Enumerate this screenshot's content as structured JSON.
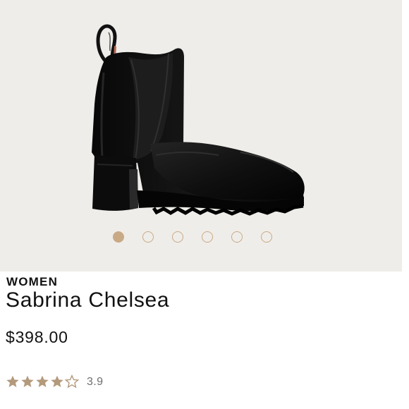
{
  "product": {
    "category": "WOMEN",
    "name": "Sabrina Chelsea",
    "price": "$398.00",
    "image_icon": "black-leather-chelsea-boot"
  },
  "gallery": {
    "image_count": 6,
    "active_index": 0,
    "dot_color": "#c9aa86"
  },
  "rating": {
    "value": "3.9",
    "max": 5,
    "filled_stars": 4,
    "star_color": "#b49a7d"
  },
  "colors": {
    "gallery_background": "#efede9",
    "text": "#111111",
    "muted_text": "#6f6f6f"
  }
}
